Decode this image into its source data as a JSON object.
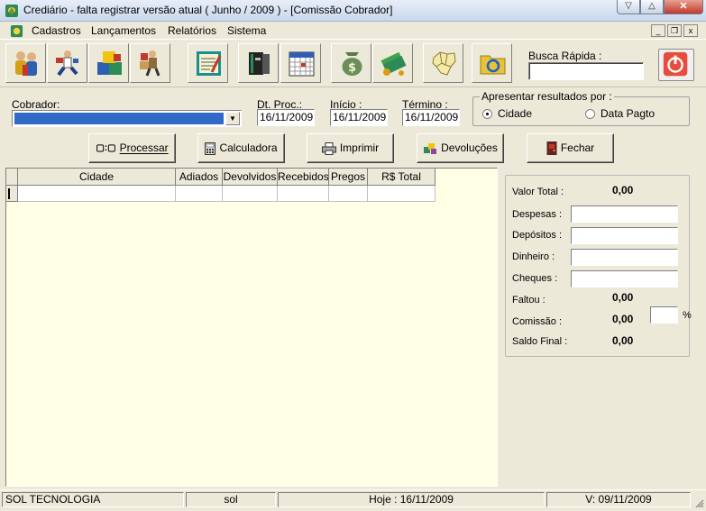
{
  "window": {
    "title": "Crediário - falta registrar versão atual ( Junho / 2009 ) - [Comissão Cobrador]",
    "controls": {
      "minimize": "▽",
      "maximize": "△",
      "close": "✕"
    }
  },
  "menu": {
    "items": [
      "Cadastros",
      "Lançamentos",
      "Relatórios",
      "Sistema"
    ],
    "mdi_controls": {
      "minimize": "_",
      "restore": "❐",
      "close": "x"
    }
  },
  "toolbar": {
    "buttons": [
      {
        "icon": "people-icon"
      },
      {
        "icon": "runner-icon"
      },
      {
        "icon": "boxes-icon"
      },
      {
        "icon": "delivery-icon"
      },
      {
        "icon": "notepad-icon"
      },
      {
        "icon": "binder-icon"
      },
      {
        "icon": "calendar-icon"
      },
      {
        "icon": "money-bag-icon"
      },
      {
        "icon": "money-coins-icon"
      },
      {
        "icon": "map-icon"
      },
      {
        "icon": "folder-refresh-icon"
      }
    ],
    "busca_label": "Busca Rápida :",
    "busca_value": "",
    "power_icon": "power-icon"
  },
  "filters": {
    "cobrador_label": "Cobrador:",
    "cobrador_value": "",
    "dt_proc_label": "Dt. Proc.:",
    "dt_proc_value": "16/11/2009",
    "inicio_label": "Início :",
    "inicio_value": "16/11/2009",
    "termino_label": "Término :",
    "termino_value": "16/11/2009",
    "resultados_label": "Apresentar resultados por :",
    "option_cidade": "Cidade",
    "option_data_pagto": "Data Pagto",
    "selected": "Cidade"
  },
  "actions": {
    "processar": "Processar",
    "calculadora": "Calculadora",
    "imprimir": "Imprimir",
    "devolucoes": "Devoluções",
    "fechar": "Fechar"
  },
  "grid": {
    "columns": [
      "Cidade",
      "Adiados",
      "Devolvidos",
      "Recebidos",
      "Pregos",
      "R$ Total"
    ],
    "rows": [
      [
        "",
        "",
        "",
        "",
        "",
        ""
      ]
    ]
  },
  "summary": {
    "valor_total_label": "Valor Total :",
    "valor_total": "0,00",
    "despesas_label": "Despesas :",
    "depositos_label": "Depósitos :",
    "dinheiro_label": "Dinheiro :",
    "cheques_label": "Cheques :",
    "faltou_label": "Faltou :",
    "faltou": "0,00",
    "comissao_label": "Comissão :",
    "comissao": "0,00",
    "pct_symbol": "%",
    "saldo_final_label": "Saldo Final :",
    "saldo_final": "0,00"
  },
  "statusbar": {
    "company": "SOL TECNOLOGIA",
    "user": "sol",
    "hoje": "Hoje : 16/11/2009",
    "version": "V: 09/11/2009"
  },
  "colors": {
    "window_bg": "#ece9d8",
    "grid_bg": "#ffffe6",
    "selection": "#3169c6",
    "power_red": "#e74c3c"
  }
}
